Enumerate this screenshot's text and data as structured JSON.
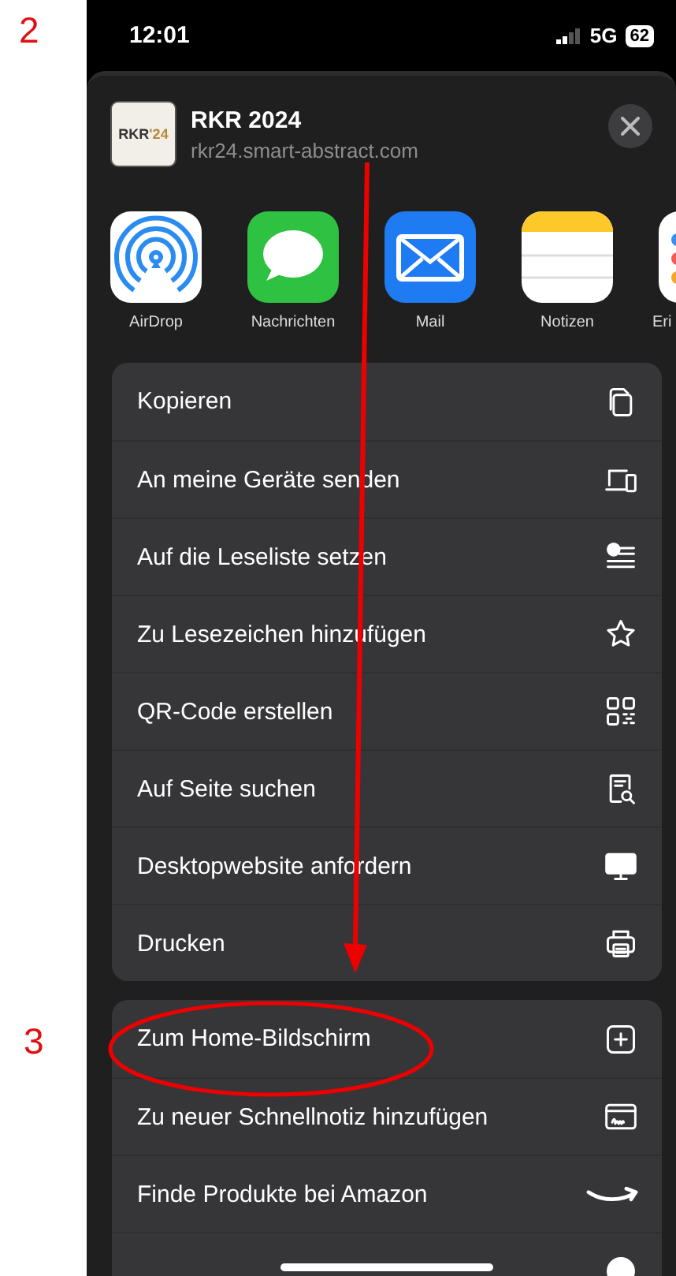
{
  "annotations": [
    {
      "label": "2"
    },
    {
      "label": "3"
    }
  ],
  "status_bar": {
    "time": "12:01",
    "network": "5G",
    "battery": "62"
  },
  "share_header": {
    "logo_text": "RKR",
    "logo_year": "'24",
    "title": "RKR 2024",
    "url": "rkr24.smart-abstract.com"
  },
  "apps": [
    {
      "label": "AirDrop",
      "kind": "airdrop"
    },
    {
      "label": "Nachrichten",
      "kind": "messages"
    },
    {
      "label": "Mail",
      "kind": "mail"
    },
    {
      "label": "Notizen",
      "kind": "notes"
    },
    {
      "label": "Eri",
      "kind": "reminders"
    }
  ],
  "action_groups": [
    {
      "items": [
        {
          "label": "Kopieren",
          "kind": "copy"
        },
        {
          "label": "An meine Geräte senden",
          "kind": "devices"
        },
        {
          "label": "Auf die Leseliste setzen",
          "kind": "readinglist"
        },
        {
          "label": "Zu Lesezeichen hinzufügen",
          "kind": "star"
        },
        {
          "label": "QR-Code erstellen",
          "kind": "qr"
        },
        {
          "label": "Auf Seite suchen",
          "kind": "findpage"
        },
        {
          "label": "Desktopwebsite anfordern",
          "kind": "desktop"
        },
        {
          "label": "Drucken",
          "kind": "print"
        }
      ]
    },
    {
      "items": [
        {
          "label": "Zum Home-Bildschirm",
          "kind": "addsquare"
        },
        {
          "label": "Zu neuer Schnellnotiz hinzufügen",
          "kind": "quicknote"
        },
        {
          "label": "Finde Produkte bei Amazon",
          "kind": "amazon"
        },
        {
          "kind": "chrome"
        }
      ]
    }
  ]
}
